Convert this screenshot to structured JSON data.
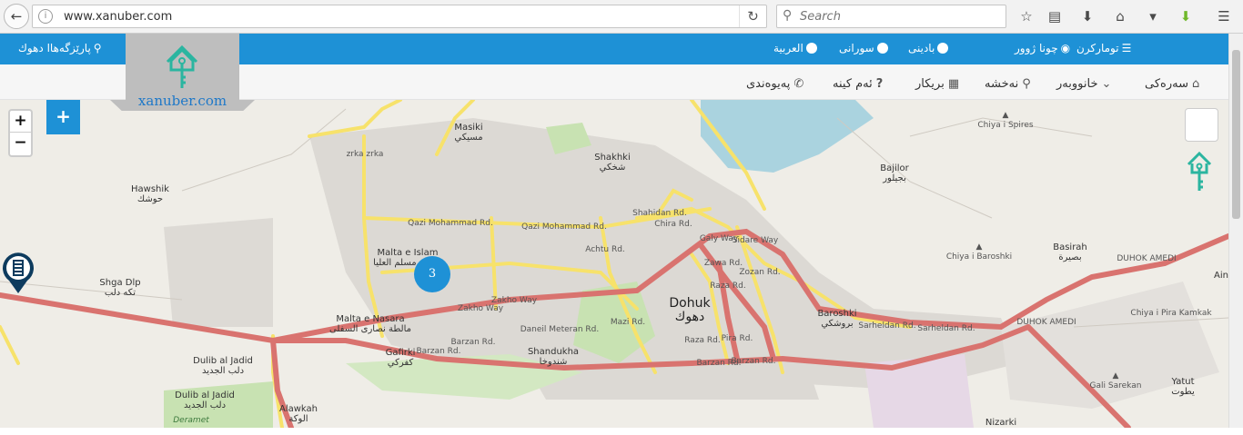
{
  "browser": {
    "url": "www.xanuber.com",
    "search_placeholder": "Search",
    "icons": [
      "back-arrow-icon",
      "info-icon",
      "reload-icon",
      "search-icon",
      "star-icon",
      "reader-icon",
      "download-icon",
      "home-icon",
      "pocket-icon",
      "addon-icon",
      "menu-icon"
    ]
  },
  "topbar": {
    "city": "پارێزگەهاا دهوك",
    "register": "تومارکرن",
    "login": "چونا ژوور",
    "lang_badini": "بادینی",
    "lang_sorani": "سورانی",
    "lang_arabic": "العربية"
  },
  "nav": {
    "home": "سەرەکی",
    "property": "خانووبەر",
    "map": "نەخشە",
    "office": "بریکار",
    "faq": "ئەم کینە",
    "contact": "پەیوەندی"
  },
  "logo": {
    "text": "xanuber.com"
  },
  "map": {
    "controls": {
      "zoom_in": "+",
      "zoom_out": "−",
      "add": "+"
    },
    "cluster_count": "3",
    "colors": {
      "background": "#efede7",
      "primary_road": "#d9736f",
      "secondary_road": "#f7e26b",
      "water": "#aad3df",
      "park": "#c8e2b2",
      "urban": "#dddad5"
    },
    "places": [
      {
        "name": "Masiki",
        "sub": "مسيكي"
      },
      {
        "name": "Shakhki",
        "sub": "شخكي"
      },
      {
        "name": "Hawshik",
        "sub": "حوشك"
      },
      {
        "name": "Malta e Islam",
        "sub": "مالطة مسلم العليا"
      },
      {
        "name": "Shga Dlp",
        "sub": "تكه دلب"
      },
      {
        "name": "Malta e Nasara",
        "sub": "مالطة نصارى السفلى"
      },
      {
        "name": "Gafirki",
        "sub": "كفركي"
      },
      {
        "name": "Shandukha",
        "sub": "شندوخا"
      },
      {
        "name": "Dohuk",
        "sub": "دهوك"
      },
      {
        "name": "Baroshki",
        "sub": "بروشكي"
      },
      {
        "name": "Bajilor",
        "sub": "بجيلور"
      },
      {
        "name": "Basirah",
        "sub": "بصيرة"
      },
      {
        "name": "Chiya i Spires",
        "sub": ""
      },
      {
        "name": "Chiya i Baroshki",
        "sub": ""
      },
      {
        "name": "Chiya i Pira Kamkak",
        "sub": ""
      },
      {
        "name": "Gali Sarekan",
        "sub": ""
      },
      {
        "name": "Yatut",
        "sub": "يطوت"
      },
      {
        "name": "Nizarki",
        "sub": ""
      },
      {
        "name": "Dulib al Jadid",
        "sub": "دلب الجديد"
      },
      {
        "name": "Dulib al Jadid",
        "sub": "دلب الجديد"
      },
      {
        "name": "Deramet",
        "sub": ""
      },
      {
        "name": "Alawkah",
        "sub": "الوكة"
      },
      {
        "name": "Ain",
        "sub": ""
      }
    ],
    "roads": [
      "Qazi Mohammad Rd.",
      "Qazi Mohammad Rd.",
      "Zakho Way",
      "Zakho Way",
      "Barzan Rd.",
      "Barzan Rd.",
      "Barzan Rd.",
      "Barzan Rd.",
      "Sarheldan Rd.",
      "Sarheldan Rd.",
      "DUHOK AMEDI",
      "DUHOK AMEDI",
      "Daneil Meteran Rd.",
      "Mazi Rd.",
      "Raza Rd.",
      "Pira Rd.",
      "Shahidan Rd.",
      "Chira Rd.",
      "Galy Way",
      "Sidare Way",
      "Zawa Rd.",
      "Zozan Rd.",
      "Raza Rd.",
      "Achtu Rd.",
      "zrka zrka"
    ]
  }
}
